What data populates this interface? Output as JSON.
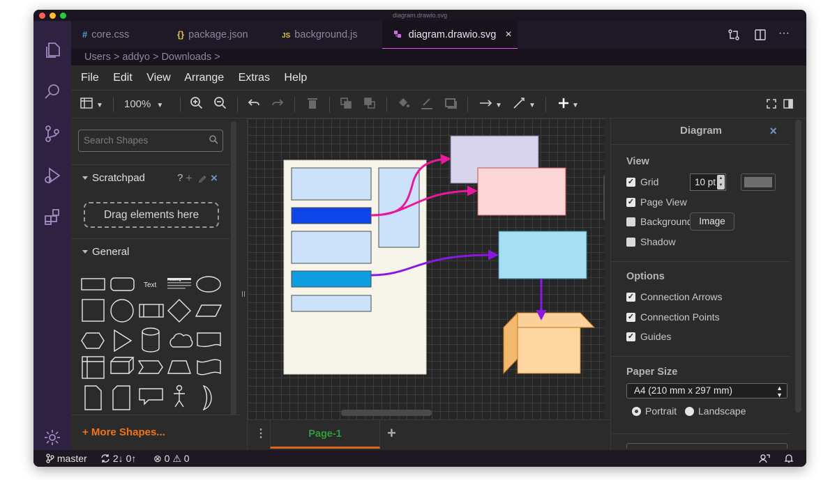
{
  "window": {
    "title": "diagram.drawio.svg"
  },
  "tabs": [
    {
      "icon": "#",
      "label": "core.css",
      "active": false
    },
    {
      "icon": "{}",
      "label": "package.json",
      "active": false
    },
    {
      "icon": "JS",
      "label": "background.js",
      "active": false
    },
    {
      "icon": "drawio-icon",
      "label": "diagram.drawio.svg",
      "active": true
    }
  ],
  "breadcrumb": [
    "Users",
    ">",
    "addyo",
    ">",
    "Downloads",
    ">"
  ],
  "menu": [
    "File",
    "Edit",
    "View",
    "Arrange",
    "Extras",
    "Help"
  ],
  "toolbar": {
    "zoom": "100%"
  },
  "sidebar": {
    "search_placeholder": "Search Shapes",
    "scratchpad_title": "Scratchpad",
    "scratchpad_help": "?",
    "dropzone_label": "Drag elements here",
    "general_title": "General",
    "shape_text_label": "Text",
    "shape_heading_label": "Heading",
    "more_shapes": "+ More Shapes..."
  },
  "pages": {
    "current": "Page-1"
  },
  "format_panel": {
    "title": "Diagram",
    "view_heading": "View",
    "grid_label": "Grid",
    "grid_size": "10 pt",
    "page_view_label": "Page View",
    "background_label": "Background",
    "image_button": "Image",
    "shadow_label": "Shadow",
    "options_heading": "Options",
    "connection_arrows": "Connection Arrows",
    "connection_points": "Connection Points",
    "guides": "Guides",
    "paper_size_heading": "Paper Size",
    "paper_size_value": "A4 (210 mm x 297 mm)",
    "portrait": "Portrait",
    "landscape": "Landscape",
    "checked": {
      "grid": true,
      "page_view": true,
      "background": false,
      "shadow": false,
      "connection_arrows": true,
      "connection_points": true,
      "guides": true
    },
    "orientation": "Portrait"
  },
  "statusbar": {
    "branch": "master",
    "sync": "2↓ 0↑",
    "errors": "0",
    "warnings": "0"
  },
  "colors": {
    "accent": "#e05af0",
    "more_shapes": "#f0731a",
    "page_tab": "#2e9d3c",
    "activity_bar": "#2d2240"
  }
}
